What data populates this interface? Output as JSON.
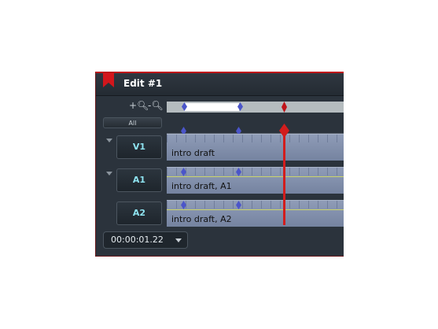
{
  "window": {
    "title": "Edit #1",
    "accent_color": "#c0141a"
  },
  "toolbar": {
    "zoom_in_icon": "zoom-in-icon",
    "zoom_out_icon": "zoom-out-icon",
    "all_label": "All"
  },
  "tracks": [
    {
      "label": "V1",
      "clip_label": "intro draft",
      "type": "video"
    },
    {
      "label": "A1",
      "clip_label": "intro draft, A1",
      "type": "audio"
    },
    {
      "label": "A2",
      "clip_label": "intro draft, A2",
      "type": "audio"
    }
  ],
  "timecode": {
    "value": "00:00:01.22"
  },
  "colors": {
    "clip": "#8f9cb7",
    "keyframe": "#4b55c9",
    "playhead": "#d21d1d",
    "track_label": "#8ee3f0"
  }
}
